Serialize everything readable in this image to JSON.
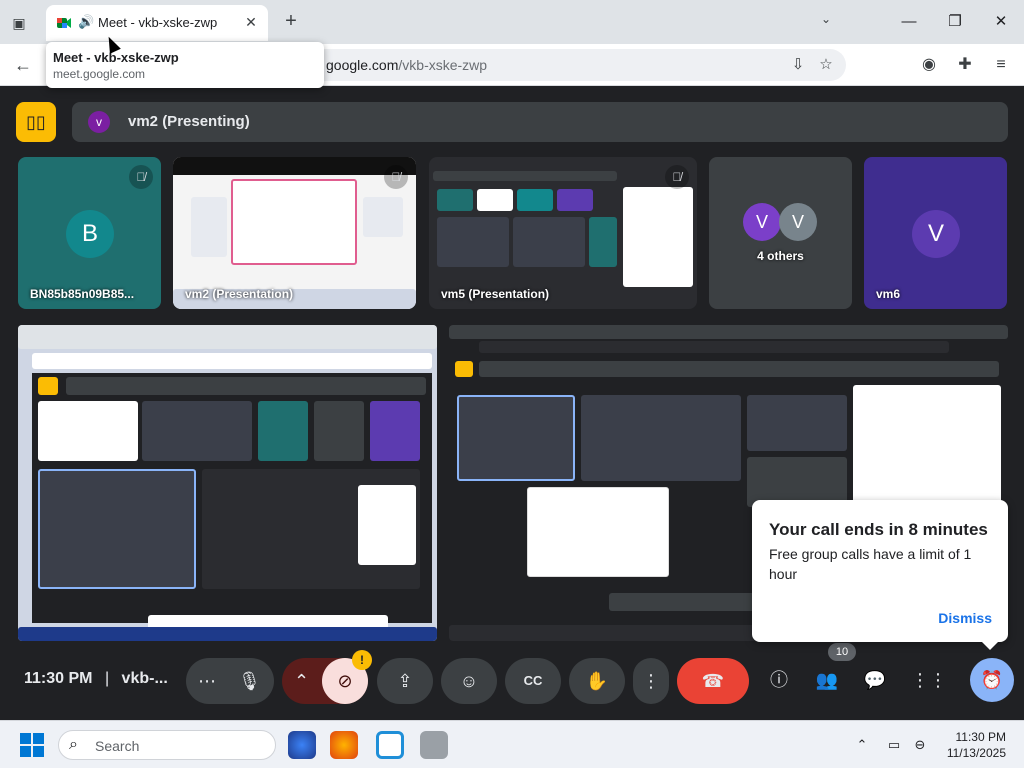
{
  "browser": {
    "tab_title": "Meet - vkb-xske-zwp",
    "tooltip_title": "Meet - vkb-xske-zwp",
    "tooltip_url": "meet.google.com",
    "url_host": "google.com",
    "url_path": "/vkb-xske-zwp"
  },
  "meet": {
    "presenter_avatar": "v",
    "presenter_label": "vm2 (Presenting)",
    "tiles": [
      {
        "name": "BN85b85n09B85...",
        "avatar": "B",
        "avatar_color": "#12888d",
        "bg": "#1f6f6f"
      },
      {
        "name": "vm2 (Presentation)"
      },
      {
        "name": "vm5 (Presentation)"
      },
      {
        "name": "4 others",
        "avatars": [
          "V",
          "V"
        ]
      },
      {
        "name": "vm6",
        "avatar": "V",
        "avatar_color": "#5c3bb0",
        "bg": "#3f2d8f"
      }
    ],
    "toast": {
      "title": "Your call ends in 8 minutes",
      "body": "Free group calls have a limit of 1 hour",
      "dismiss": "Dismiss"
    },
    "controls": {
      "time": "11:30 PM",
      "separator": "|",
      "meeting_code": "vkb-...",
      "people_count": "10",
      "warning": "!"
    }
  },
  "taskbar": {
    "search_placeholder": "Search",
    "time": "11:30 PM",
    "date": "11/13/2025"
  },
  "colors": {
    "meet_bg": "#202124",
    "accent_yellow": "#fbbc04",
    "end_call_red": "#ea4335",
    "link_blue": "#1a73e8"
  }
}
